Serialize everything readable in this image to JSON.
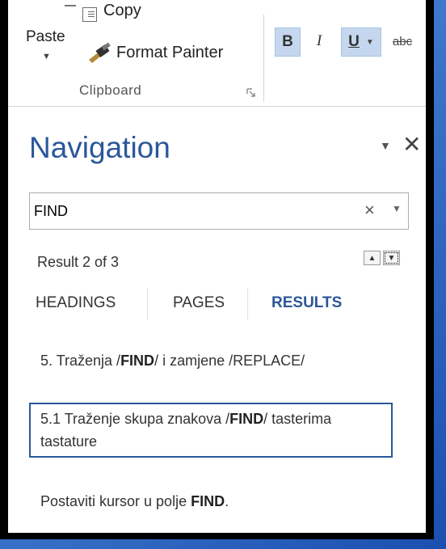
{
  "ribbon": {
    "paste_label": "Paste",
    "copy_label": "Copy",
    "format_painter_label": "Format Painter",
    "clipboard_group_label": "Clipboard",
    "bold_label": "B",
    "italic_label": "I",
    "underline_label": "U",
    "strikethrough_label": "abc",
    "overflow_label": "x"
  },
  "navigation": {
    "title": "Navigation",
    "search_value": "FIND",
    "result_count": "Result 2 of 3",
    "tabs": [
      {
        "label": "HEADINGS",
        "active": false
      },
      {
        "label": "PAGES",
        "active": false
      },
      {
        "label": "RESULTS",
        "active": true
      }
    ],
    "results": [
      {
        "before": "5. Traženja /",
        "match": "FIND",
        "after": "/ i zamjene /REPLACE/",
        "selected": false
      },
      {
        "before": "5.1 Traženje skupa znakova /",
        "match": "FIND",
        "after": "/ tasterima tastature",
        "selected": true
      },
      {
        "before": "Postaviti kursor u polje ",
        "match": "FIND",
        "after": ".",
        "selected": false
      }
    ]
  },
  "colors": {
    "accent": "#2b579a",
    "selection_fill": "#c5d7ee"
  },
  "icons": {
    "close": "close-icon",
    "clear": "clear-icon",
    "dropdown": "chevron-down-icon",
    "prev": "previous-result-icon",
    "next": "next-result-icon"
  }
}
